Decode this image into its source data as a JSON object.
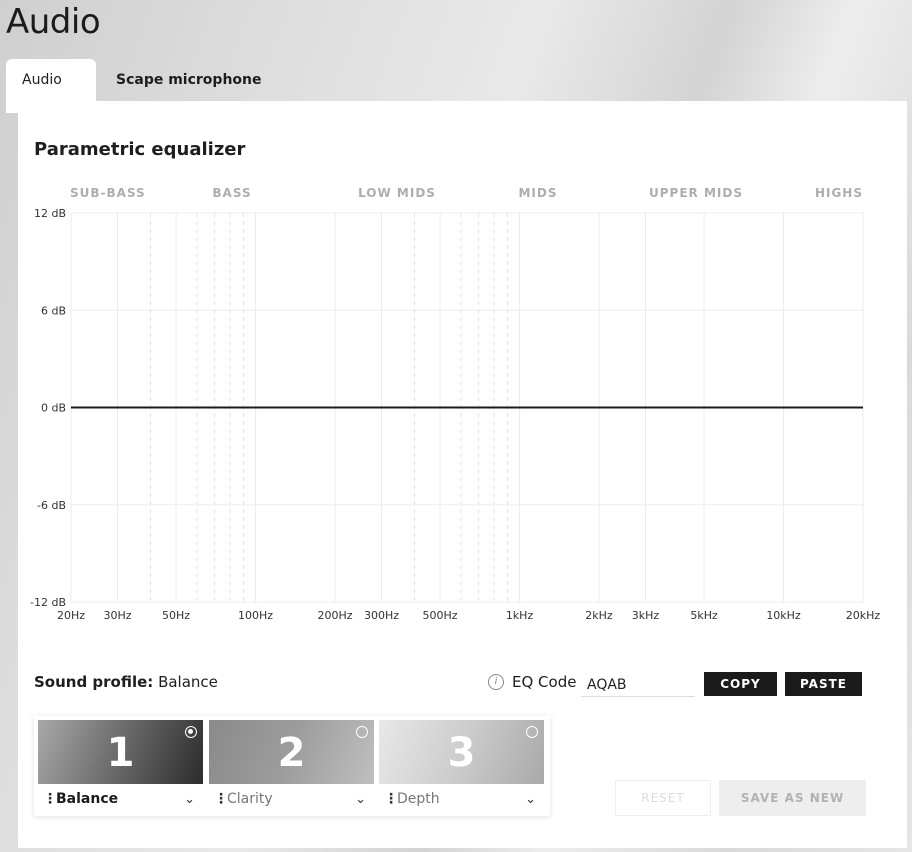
{
  "app": {
    "title": "Audio"
  },
  "tabs": [
    {
      "label": "Audio",
      "active": true
    },
    {
      "label": "Scape microphone",
      "active": false
    }
  ],
  "equalizer": {
    "title": "Parametric equalizer",
    "bands": [
      "SUB-BASS",
      "BASS",
      "LOW MIDS",
      "MIDS",
      "UPPER MIDS",
      "HIGHS"
    ],
    "line_color": "#1b1b1b"
  },
  "chart_data": {
    "type": "line",
    "title": "Parametric equalizer",
    "x_scale": "log",
    "xlim": [
      20,
      20000
    ],
    "ylim": [
      -12,
      12
    ],
    "x_ticks": [
      {
        "value": 20,
        "label": "20Hz"
      },
      {
        "value": 30,
        "label": "30Hz"
      },
      {
        "value": 50,
        "label": "50Hz"
      },
      {
        "value": 100,
        "label": "100Hz"
      },
      {
        "value": 200,
        "label": "200Hz"
      },
      {
        "value": 300,
        "label": "300Hz"
      },
      {
        "value": 500,
        "label": "500Hz"
      },
      {
        "value": 1000,
        "label": "1kHz"
      },
      {
        "value": 2000,
        "label": "2kHz"
      },
      {
        "value": 3000,
        "label": "3kHz"
      },
      {
        "value": 5000,
        "label": "5kHz"
      },
      {
        "value": 10000,
        "label": "10kHz"
      },
      {
        "value": 20000,
        "label": "20kHz"
      }
    ],
    "y_ticks": [
      {
        "value": 12,
        "label": "12 dB"
      },
      {
        "value": 6,
        "label": "6 dB"
      },
      {
        "value": 0,
        "label": "0 dB"
      },
      {
        "value": -6,
        "label": "-6 dB"
      },
      {
        "value": -12,
        "label": "-12 dB"
      }
    ],
    "minor_x": [
      40,
      60,
      70,
      80,
      90,
      400,
      600,
      700,
      800,
      900
    ],
    "series": [
      {
        "x": [
          20,
          20000
        ],
        "y": [
          0,
          0
        ]
      }
    ],
    "grid": true
  },
  "sound_profile": {
    "label": "Sound profile:",
    "value": "Balance"
  },
  "eq_code": {
    "label": "EQ Code",
    "value": "AQAB",
    "info_icon": "info-icon"
  },
  "buttons": {
    "copy": "COPY",
    "paste": "PASTE",
    "reset": "RESET",
    "save_as_new": "SAVE AS NEW"
  },
  "profiles": [
    {
      "number": "1",
      "name": "Balance",
      "selected": true
    },
    {
      "number": "2",
      "name": "Clarity",
      "selected": false
    },
    {
      "number": "3",
      "name": "Depth",
      "selected": false
    }
  ]
}
